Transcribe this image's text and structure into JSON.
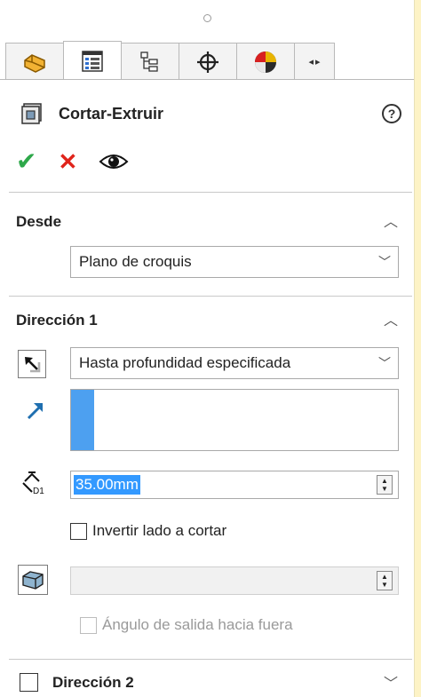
{
  "tabs": [
    {
      "name": "feature-manager-tab",
      "icon": "feature-manager-icon"
    },
    {
      "name": "property-manager-tab",
      "icon": "property-manager-icon",
      "active": true
    },
    {
      "name": "configuration-manager-tab",
      "icon": "configuration-manager-icon"
    },
    {
      "name": "dimxpert-manager-tab",
      "icon": "crosshair-icon"
    },
    {
      "name": "display-manager-tab",
      "icon": "display-manager-icon"
    }
  ],
  "title": "Cortar-Extruir",
  "help": "?",
  "actions": {
    "ok": "✔",
    "cancel": "✕"
  },
  "desde": {
    "title": "Desde",
    "selected": "Plano de croquis"
  },
  "direccion1": {
    "title": "Dirección 1",
    "end_condition": "Hasta profundidad especificada",
    "depth": "35.00mm",
    "flip_side_label": "Invertir lado a cortar",
    "draft_label": "Ángulo de salida hacia fuera"
  },
  "direccion2": {
    "title": "Dirección 2"
  },
  "colors": {
    "ok": "#2ea84a",
    "cancel": "#e0241b",
    "selection": "#3399ff",
    "background": "#fdf3c6"
  }
}
